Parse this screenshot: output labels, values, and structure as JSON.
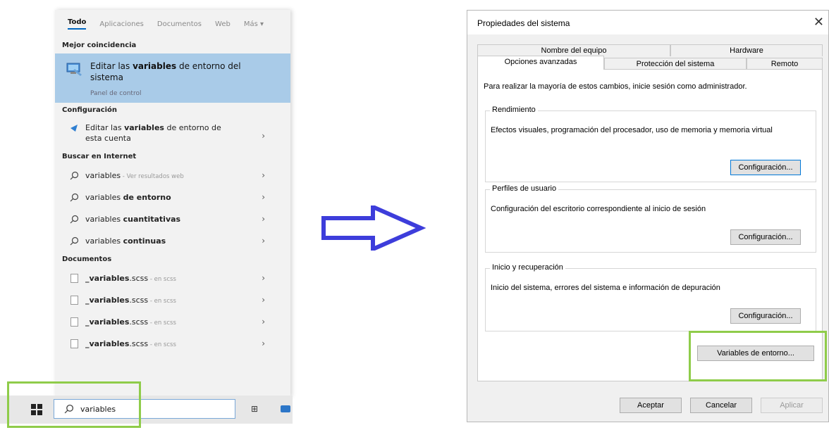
{
  "search": {
    "tabs": [
      "Todo",
      "Aplicaciones",
      "Documentos",
      "Web",
      "Más ▾"
    ],
    "best_match_heading": "Mejor coincidencia",
    "best_match": {
      "title_pre": "Editar las ",
      "title_bold": "variables",
      "title_post": " de entorno del sistema",
      "subtitle": "Panel de control"
    },
    "config_heading": "Configuración",
    "config_item": {
      "pre": "Editar las ",
      "bold": "variables",
      "post": " de entorno de esta cuenta"
    },
    "internet_heading": "Buscar en Internet",
    "internet_items": [
      {
        "normal": "variables",
        "bold": "",
        "muted": " - Ver resultados web"
      },
      {
        "normal": "variables ",
        "bold": "de entorno",
        "muted": ""
      },
      {
        "normal": "variables ",
        "bold": "cuantitativas",
        "muted": ""
      },
      {
        "normal": "variables ",
        "bold": "continuas",
        "muted": ""
      }
    ],
    "documents_heading": "Documentos",
    "documents": [
      {
        "bold": "_variables",
        "normal": ".scss",
        "muted": " - en scss"
      },
      {
        "bold": "_variables",
        "normal": ".scss",
        "muted": " - en scss"
      },
      {
        "bold": "_variables",
        "normal": ".scss",
        "muted": " - en scss"
      },
      {
        "bold": "_variables",
        "normal": ".scss",
        "muted": " - en scss"
      }
    ],
    "chevron": "›"
  },
  "taskbar": {
    "search_value": "variables",
    "task_view_glyph": "⊞"
  },
  "dialog": {
    "title": "Propiedades del sistema",
    "close_glyph": "✕",
    "tabs_back": [
      "Nombre del equipo",
      "Hardware"
    ],
    "tabs_front": [
      "Opciones avanzadas",
      "Protección del sistema",
      "Remoto"
    ],
    "admin_note": "Para realizar la mayoría de estos cambios, inicie sesión como administrador.",
    "groups": [
      {
        "title": "Rendimiento",
        "desc": "Efectos visuales, programación del procesador, uso de memoria y memoria virtual",
        "button": "Configuración..."
      },
      {
        "title": "Perfiles de usuario",
        "desc": "Configuración del escritorio correspondiente al inicio de sesión",
        "button": "Configuración..."
      },
      {
        "title": "Inicio y recuperación",
        "desc": "Inicio del sistema, errores del sistema e información de depuración",
        "button": "Configuración..."
      }
    ],
    "env_button": "Variables de entorno...",
    "footer_buttons": [
      "Aceptar",
      "Cancelar",
      "Aplicar"
    ]
  },
  "colors": {
    "highlight": "#8fcc4a",
    "selection": "#a9cbe8",
    "arrow": "#3d3ddb"
  }
}
